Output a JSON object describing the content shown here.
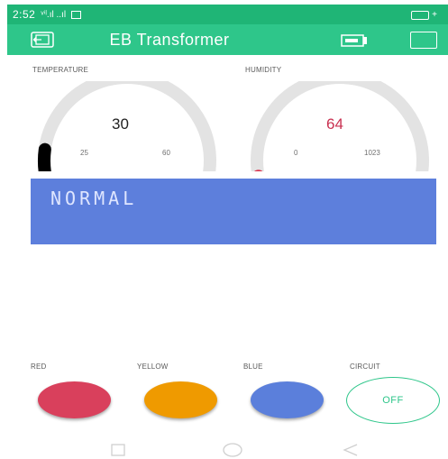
{
  "status_bar": {
    "time": "2:52",
    "signal": "ᵛⁱˡ.ıl ..ıl",
    "battery_suffix": "+"
  },
  "app": {
    "title": "EB Transformer"
  },
  "widgets": {
    "temperature": {
      "label": "TEMPERATURE",
      "value": "30",
      "min": "25",
      "max": "60",
      "value_num": 30,
      "min_num": 25,
      "max_num": 60,
      "color": "#000000",
      "value_color": "#222222"
    },
    "humidity": {
      "label": "HUMIDITY",
      "value": "64",
      "min": "0",
      "max": "1023",
      "value_num": 64,
      "min_num": 0,
      "max_num": 1023,
      "color": "#d9344f",
      "value_color": "#c93050"
    },
    "lcd": {
      "text": "NORMAL",
      "background": "#5d7fdc"
    },
    "buttons": [
      {
        "label": "RED",
        "color": "#d9405c"
      },
      {
        "label": "YELLOW",
        "color": "#ef9a00"
      },
      {
        "label": "BLUE",
        "color": "#5b7fdb"
      },
      {
        "label": "CIRCUIT",
        "state": "OFF",
        "color": "#2ec68a"
      }
    ]
  },
  "colors": {
    "status_bar": "#1fb576",
    "app_bar": "#2ec68a",
    "gauge_track": "#e3e3e3"
  },
  "nav_icons": [
    "recent-apps-icon",
    "home-icon",
    "back-icon"
  ]
}
